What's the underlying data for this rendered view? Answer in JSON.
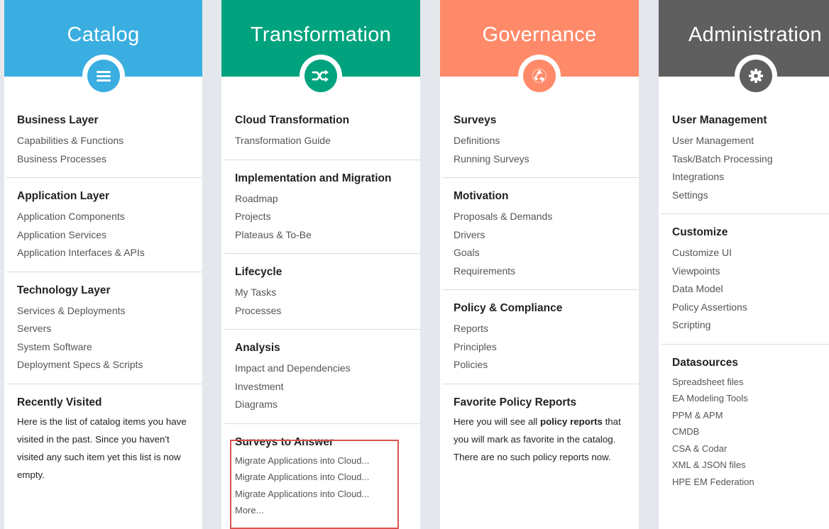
{
  "colors": {
    "catalog": "#3aaee0",
    "transformation": "#00a37e",
    "governance": "#ff8a6a",
    "administration": "#5f5f5f",
    "highlight": "#d9534f"
  },
  "catalog": {
    "title": "Catalog",
    "icon": "menu-icon",
    "sections": [
      {
        "title": "Business Layer",
        "items": [
          "Capabilities & Functions",
          "Business Processes"
        ]
      },
      {
        "title": "Application Layer",
        "items": [
          "Application Components",
          "Application Services",
          "Application Interfaces & APIs"
        ]
      },
      {
        "title": "Technology Layer",
        "items": [
          "Services & Deployments",
          "Servers",
          "System Software",
          "Deployment Specs & Scripts"
        ]
      }
    ],
    "recent": {
      "title": "Recently Visited",
      "text": "Here is the list of catalog items you have visited in the past. Since you haven't visited any such item yet this list is now empty."
    }
  },
  "transformation": {
    "title": "Transformation",
    "icon": "shuffle-icon",
    "sections": [
      {
        "title": "Cloud Transformation",
        "items": [
          "Transformation Guide"
        ]
      },
      {
        "title": "Implementation and Migration",
        "items": [
          "Roadmap",
          "Projects",
          "Plateaus & To-Be"
        ]
      },
      {
        "title": "Lifecycle",
        "items": [
          "My Tasks",
          "Processes"
        ]
      },
      {
        "title": "Analysis",
        "items": [
          "Impact and Dependencies",
          "Investment",
          "Diagrams"
        ]
      }
    ],
    "surveys": {
      "title": "Surveys to Answer",
      "items": [
        "Migrate Applications into Cloud...",
        "Migrate Applications into Cloud...",
        "Migrate Applications into Cloud..."
      ],
      "more": "More..."
    }
  },
  "governance": {
    "title": "Governance",
    "icon": "recycle-icon",
    "sections": [
      {
        "title": "Surveys",
        "items": [
          "Definitions",
          "Running Surveys"
        ]
      },
      {
        "title": "Motivation",
        "items": [
          "Proposals & Demands",
          "Drivers",
          "Goals",
          "Requirements"
        ]
      },
      {
        "title": "Policy & Compliance",
        "items": [
          "Reports",
          "Principles",
          "Policies"
        ]
      }
    ],
    "favorites": {
      "title": "Favorite Policy Reports",
      "text_before": "Here you will see all ",
      "text_bold": "policy reports",
      "text_after": " that you will mark as favorite in the catalog. There are no such policy reports now."
    }
  },
  "administration": {
    "title": "Administration",
    "icon": "gear-icon",
    "sections": [
      {
        "title": "User Management",
        "items": [
          "User Management",
          "Task/Batch Processing",
          "Integrations",
          "Settings"
        ]
      },
      {
        "title": "Customize",
        "items": [
          "Customize UI",
          "Viewpoints",
          "Data Model",
          "Policy Assertions",
          "Scripting"
        ]
      }
    ],
    "datasources": {
      "title": "Datasources",
      "items": [
        "Spreadsheet files",
        "EA Modeling Tools",
        "PPM & APM",
        "CMDB",
        "CSA & Codar",
        "XML & JSON files",
        "HPE EM Federation"
      ]
    }
  }
}
